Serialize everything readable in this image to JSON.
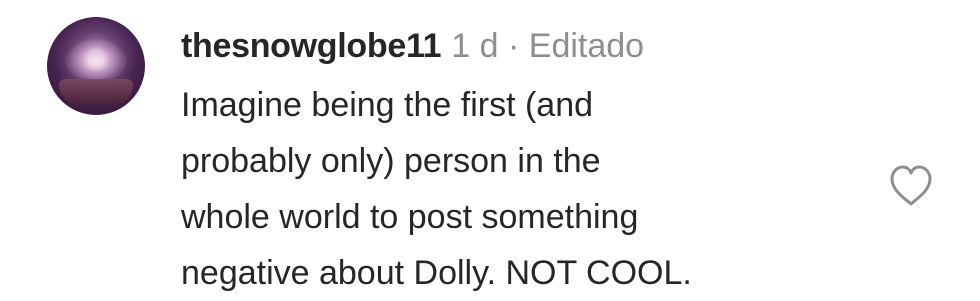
{
  "comment": {
    "username": "thesnowglobe11",
    "meta": "1 d · Editado",
    "text_lines": [
      "Imagine being the first (and",
      "probably only) person in the",
      "whole world to post something",
      "negative about Dolly. NOT COOL."
    ],
    "like_icon": "heart-outline-icon"
  }
}
